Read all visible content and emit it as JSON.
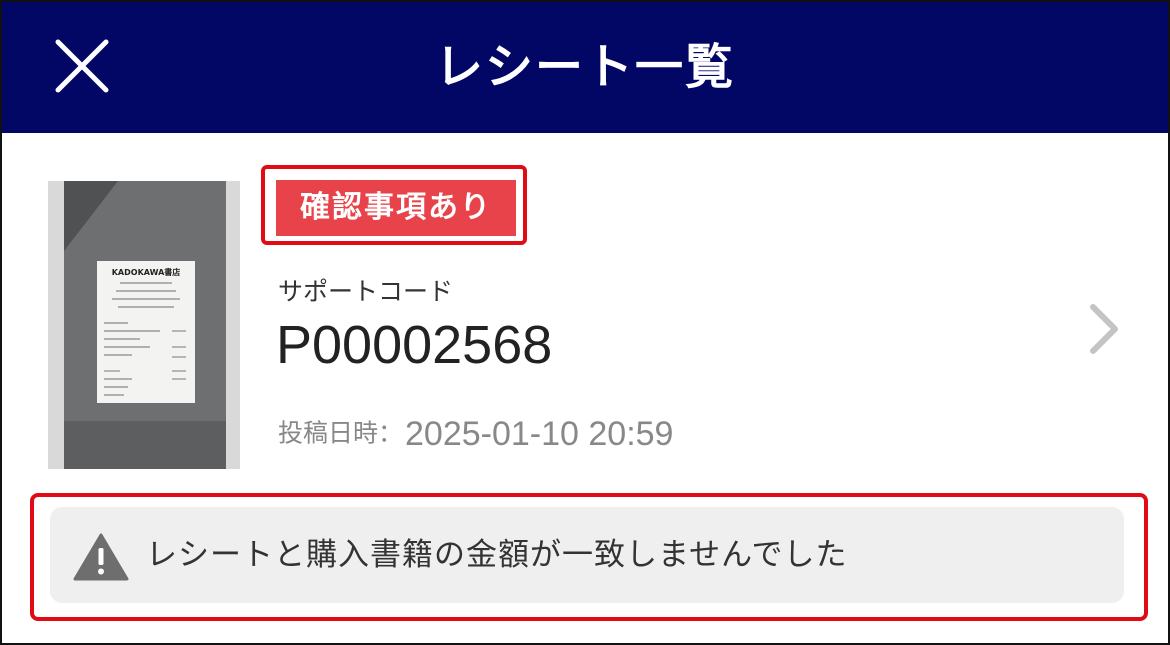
{
  "header": {
    "title": "レシート一覧",
    "close_icon": "close-icon",
    "background": "#020766"
  },
  "receipt": {
    "badge": "確認事項あり",
    "badge_color": "#e8434b",
    "support_code_label": "サポートコード",
    "support_code": "P00002568",
    "posted_label": "投稿日時：",
    "posted_value": "2025-01-10 20:59",
    "thumbnail": {
      "store_name": "KADOKAWA書店"
    },
    "chevron_icon": "chevron-right-icon"
  },
  "alert": {
    "icon": "warning-icon",
    "message": "レシートと購入書籍の金額が一致しませんでした"
  },
  "highlight_color": "#e10b16"
}
